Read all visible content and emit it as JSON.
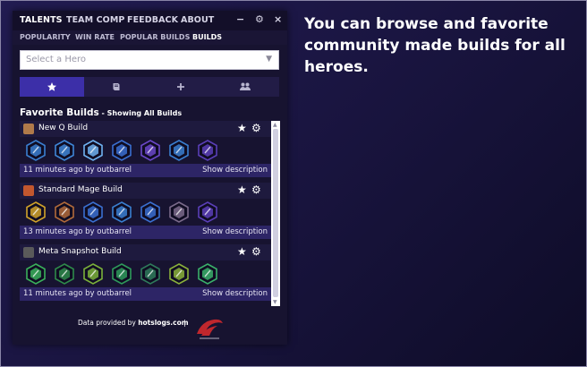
{
  "caption": "You can browse and favorite community made builds for all heroes.",
  "topnav": {
    "items": [
      "TALENTS",
      "TEAM COMP",
      "FEEDBACK",
      "ABOUT"
    ],
    "minimize": "−",
    "settings": "⚙",
    "close": "×"
  },
  "subnav": {
    "items": [
      "POPULARITY",
      "WIN RATE",
      "POPULAR BUILDS",
      "BUILDS"
    ],
    "active": "BUILDS"
  },
  "hero_select": {
    "placeholder": "Select a Hero"
  },
  "tabs": [
    {
      "icon": "star-icon"
    },
    {
      "icon": "book-icon"
    },
    {
      "icon": "plus-icon"
    },
    {
      "icon": "users-icon"
    }
  ],
  "section": {
    "title": "Favorite Builds",
    "subtitle": " - Showing All Builds"
  },
  "builds": [
    {
      "name": "New Q Build",
      "meta": "11 minutes ago by outbarrel",
      "action": "Show description",
      "portrait_color": "#b07a4a",
      "talent_colors": [
        "#3a7fd0",
        "#3f86d6",
        "#6fb2f0",
        "#3a6fd0",
        "#6a48c8",
        "#3a7fd0",
        "#5a3fb8"
      ]
    },
    {
      "name": "Standard Mage Build",
      "meta": "13 minutes ago by outbarrel",
      "action": "Show description",
      "portrait_color": "#c2572e",
      "talent_colors": [
        "#d0a22a",
        "#b06a3a",
        "#3a6fd0",
        "#3a7fd0",
        "#3a6fd0",
        "#7a6a8a",
        "#5a3fb8"
      ]
    },
    {
      "name": "Meta Snapshot Build",
      "meta": "11 minutes ago by outbarrel",
      "action": "Show description",
      "portrait_color": "#5a5a5a",
      "talent_colors": [
        "#3ab05a",
        "#2e8a4a",
        "#7ab03a",
        "#2e9a5a",
        "#2e7a5a",
        "#8ab03a",
        "#3ab06a"
      ]
    }
  ],
  "footer": {
    "prefix": "Data provided by ",
    "link": "hotslogs.com",
    "separator": "|"
  }
}
